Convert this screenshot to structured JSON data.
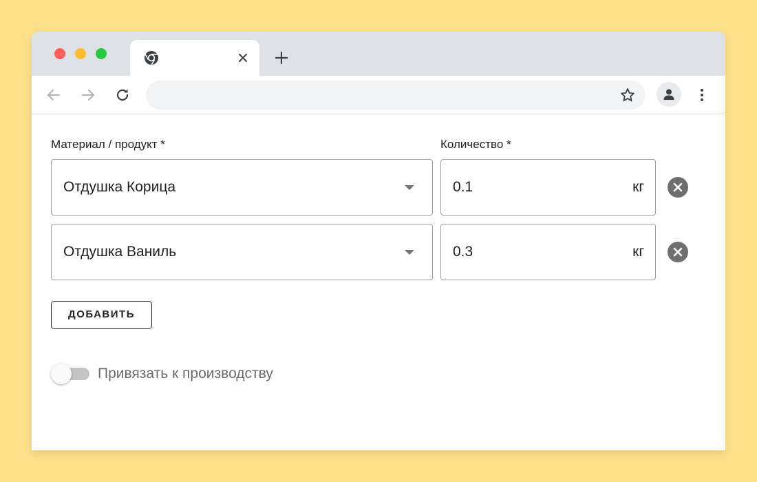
{
  "browser": {
    "tab": {
      "favicon": "chrome-icon",
      "title": ""
    },
    "address_bar": {
      "value": ""
    },
    "icons": {
      "back": "arrow-left-icon",
      "forward": "arrow-right-icon",
      "reload": "reload-icon",
      "bookmark": "star-icon",
      "profile": "user-icon",
      "menu": "kebab-menu-icon",
      "close_tab": "close-icon",
      "new_tab": "plus-icon"
    }
  },
  "form": {
    "material_label": "Материал / продукт *",
    "quantity_label": "Количество *",
    "rows": [
      {
        "material": "Отдушка Корица",
        "quantity": "0.1",
        "unit": "кг"
      },
      {
        "material": "Отдушка Ваниль",
        "quantity": "0.3",
        "unit": "кг"
      }
    ],
    "add_button": "ДОБАВИТЬ",
    "toggle": {
      "label": "Привязать к производству",
      "checked": false
    }
  },
  "colors": {
    "background": "#fde08a",
    "tabbar": "#dee1e6",
    "field_border": "#9e9e9e",
    "remove_icon": "#6f6f6f",
    "switch_track": "#c4c4c4"
  }
}
